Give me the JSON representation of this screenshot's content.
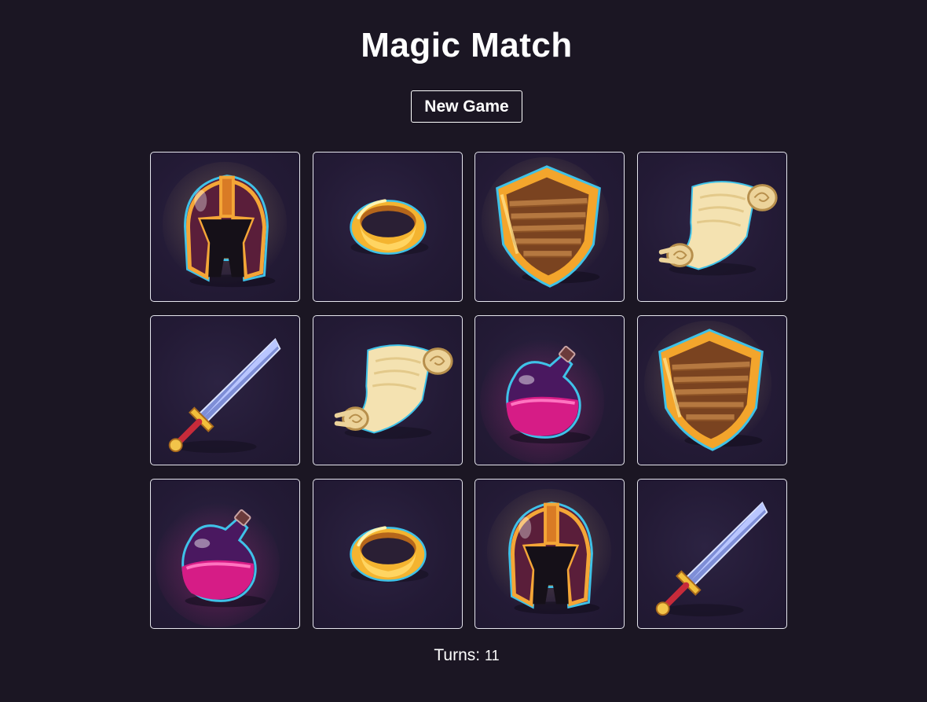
{
  "title": "Magic Match",
  "new_game_label": "New Game",
  "turns": {
    "label": "Turns:",
    "value": "11"
  },
  "cards": [
    {
      "icon": "helmet-icon",
      "flip": false
    },
    {
      "icon": "ring-icon",
      "flip": false
    },
    {
      "icon": "shield-icon",
      "flip": false
    },
    {
      "icon": "scroll-icon",
      "flip": false
    },
    {
      "icon": "sword-icon",
      "flip": false
    },
    {
      "icon": "scroll-icon",
      "flip": false
    },
    {
      "icon": "potion-icon",
      "flip": false
    },
    {
      "icon": "shield-icon",
      "flip": false
    },
    {
      "icon": "potion-icon",
      "flip": false
    },
    {
      "icon": "ring-icon",
      "flip": false
    },
    {
      "icon": "helmet-icon",
      "flip": false
    },
    {
      "icon": "sword-icon",
      "flip": false
    }
  ],
  "colors": {
    "background": "#1b1623",
    "card_background": "#231a35",
    "card_border": "#e6e6ee",
    "gold": "#f5b733",
    "accent_blue": "#3fc2e8"
  }
}
